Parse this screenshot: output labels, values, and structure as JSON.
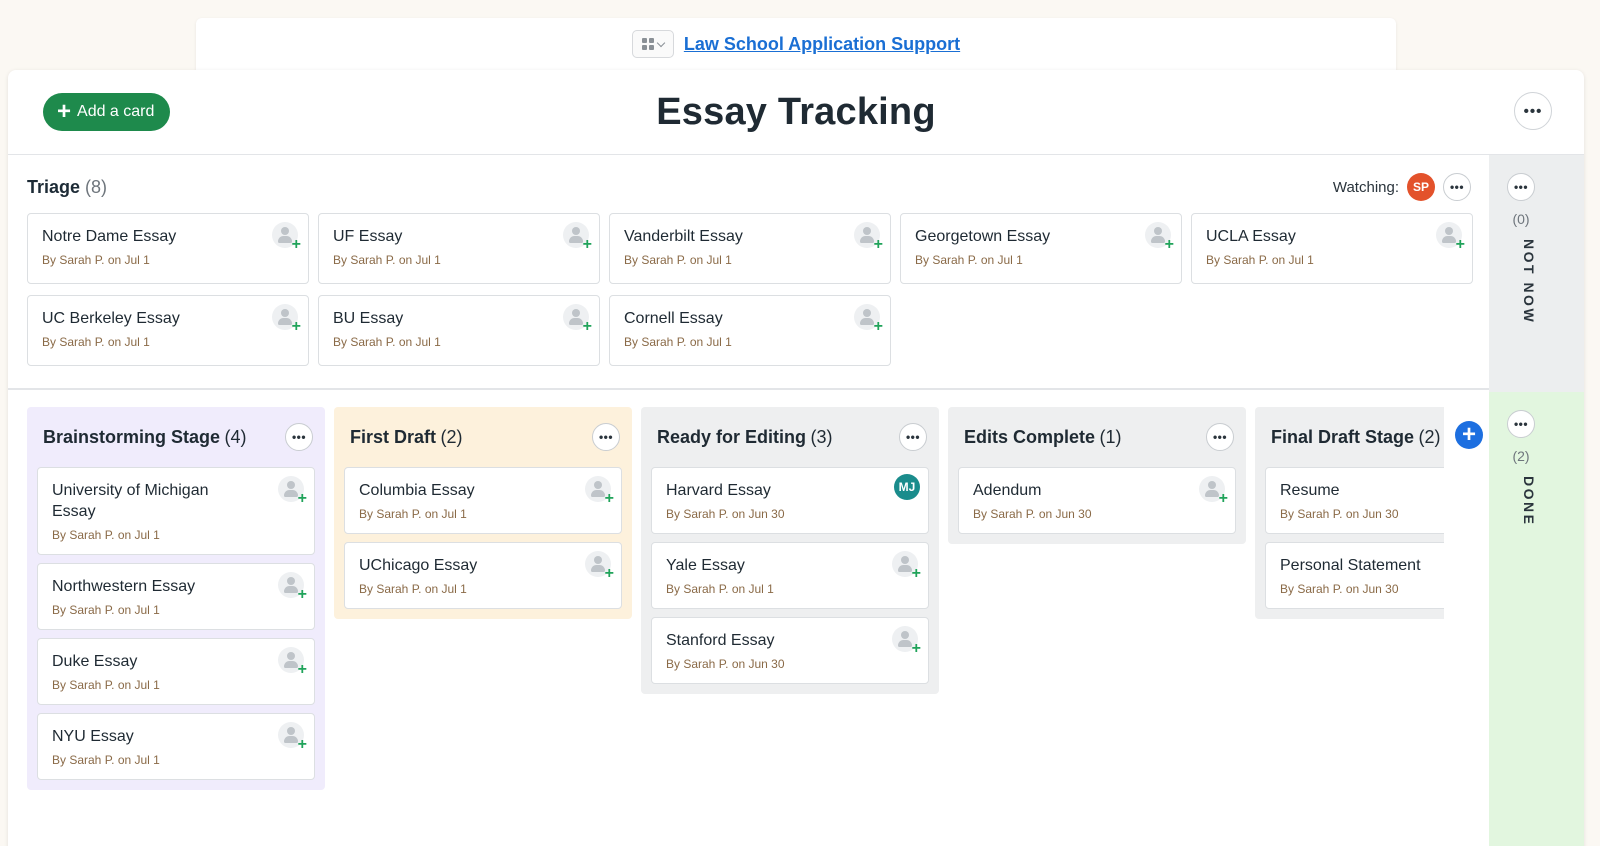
{
  "topbar": {
    "project_link": "Law School Application Support"
  },
  "header": {
    "add_card_label": "Add a card",
    "title": "Essay Tracking",
    "more": "•••"
  },
  "triage": {
    "title": "Triage",
    "count": "(8)",
    "watching_label": "Watching:",
    "watcher_initials": "SP",
    "cards": [
      {
        "title": "Notre Dame Essay",
        "meta": "By Sarah P. on Jul 1"
      },
      {
        "title": "UF Essay",
        "meta": "By Sarah P. on Jul 1"
      },
      {
        "title": "Vanderbilt Essay",
        "meta": "By Sarah P. on Jul 1"
      },
      {
        "title": "Georgetown Essay",
        "meta": "By Sarah P. on Jul 1"
      },
      {
        "title": "UCLA Essay",
        "meta": "By Sarah P. on Jul 1"
      },
      {
        "title": "UC Berkeley Essay",
        "meta": "By Sarah P. on Jul 1"
      },
      {
        "title": "BU Essay",
        "meta": "By Sarah P. on Jul 1"
      },
      {
        "title": "Cornell Essay",
        "meta": "By Sarah P. on Jul 1"
      }
    ]
  },
  "side": {
    "not_now": {
      "count": "(0)",
      "label": "NOT NOW"
    },
    "done": {
      "count": "(2)",
      "label": "DONE"
    }
  },
  "lanes": [
    {
      "title": "Brainstorming Stage",
      "count": "(4)",
      "cards": [
        {
          "title": "University of Michigan Essay",
          "meta": "By Sarah P. on Jul 1"
        },
        {
          "title": "Northwestern Essay",
          "meta": "By Sarah P. on Jul 1"
        },
        {
          "title": "Duke Essay",
          "meta": "By Sarah P. on Jul 1"
        },
        {
          "title": "NYU Essay",
          "meta": "By Sarah P. on Jul 1"
        }
      ]
    },
    {
      "title": "First Draft",
      "count": "(2)",
      "cards": [
        {
          "title": "Columbia Essay",
          "meta": "By Sarah P. on Jul 1"
        },
        {
          "title": "UChicago Essay",
          "meta": "By Sarah P. on Jul 1"
        }
      ]
    },
    {
      "title": "Ready for Editing",
      "count": "(3)",
      "cards": [
        {
          "title": "Harvard Essay",
          "meta": "By Sarah P. on Jun 30",
          "assignee": "MJ"
        },
        {
          "title": "Yale Essay",
          "meta": "By Sarah P. on Jul 1"
        },
        {
          "title": "Stanford Essay",
          "meta": "By Sarah P. on Jun 30"
        }
      ]
    },
    {
      "title": "Edits Complete",
      "count": "(1)",
      "cards": [
        {
          "title": "Adendum",
          "meta": "By Sarah P. on Jun 30"
        }
      ]
    },
    {
      "title": "Final Draft Stage",
      "count": "(2)",
      "cards": [
        {
          "title": "Resume",
          "meta": "By Sarah P. on Jun 30"
        },
        {
          "title": "Personal Statement",
          "meta": "By Sarah P. on Jun 30"
        }
      ]
    }
  ],
  "colors": {
    "accent_green": "#1e8a4c",
    "add_blue": "#1d6fe0",
    "brainstorm_bg": "#f0ecfc",
    "first_draft_bg": "#fdf1dc",
    "done_bg": "#e2f6df"
  },
  "icons": {
    "add_column": "+",
    "add_card": "+",
    "assign": "+"
  }
}
